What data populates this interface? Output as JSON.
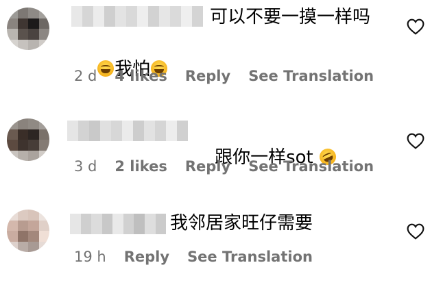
{
  "comments": [
    {
      "text_line1": "可以不要一摸一样吗",
      "text_line2": "我怕",
      "age": "2 d",
      "likes": "4 likes",
      "reply_label": "Reply",
      "translate_label": "See Translation",
      "avatar_icon": "blurred-avatar",
      "emoji_icon": "face-with-tears-of-joy-emoji"
    },
    {
      "text_line1": "跟你一样sot",
      "age": "3 d",
      "likes": "2 likes",
      "reply_label": "Reply",
      "translate_label": "See Translation",
      "avatar_icon": "blurred-avatar",
      "emoji_icon": "rolling-on-floor-laughing-emoji"
    },
    {
      "text_line1": "我邻居家旺仔需要",
      "age": "19 h",
      "reply_label": "Reply",
      "translate_label": "See Translation",
      "avatar_icon": "blurred-avatar"
    }
  ],
  "heart_icon": "heart-outline-icon",
  "colors": {
    "meta_text": "#737373",
    "text": "#000000",
    "background": "#ffffff"
  }
}
